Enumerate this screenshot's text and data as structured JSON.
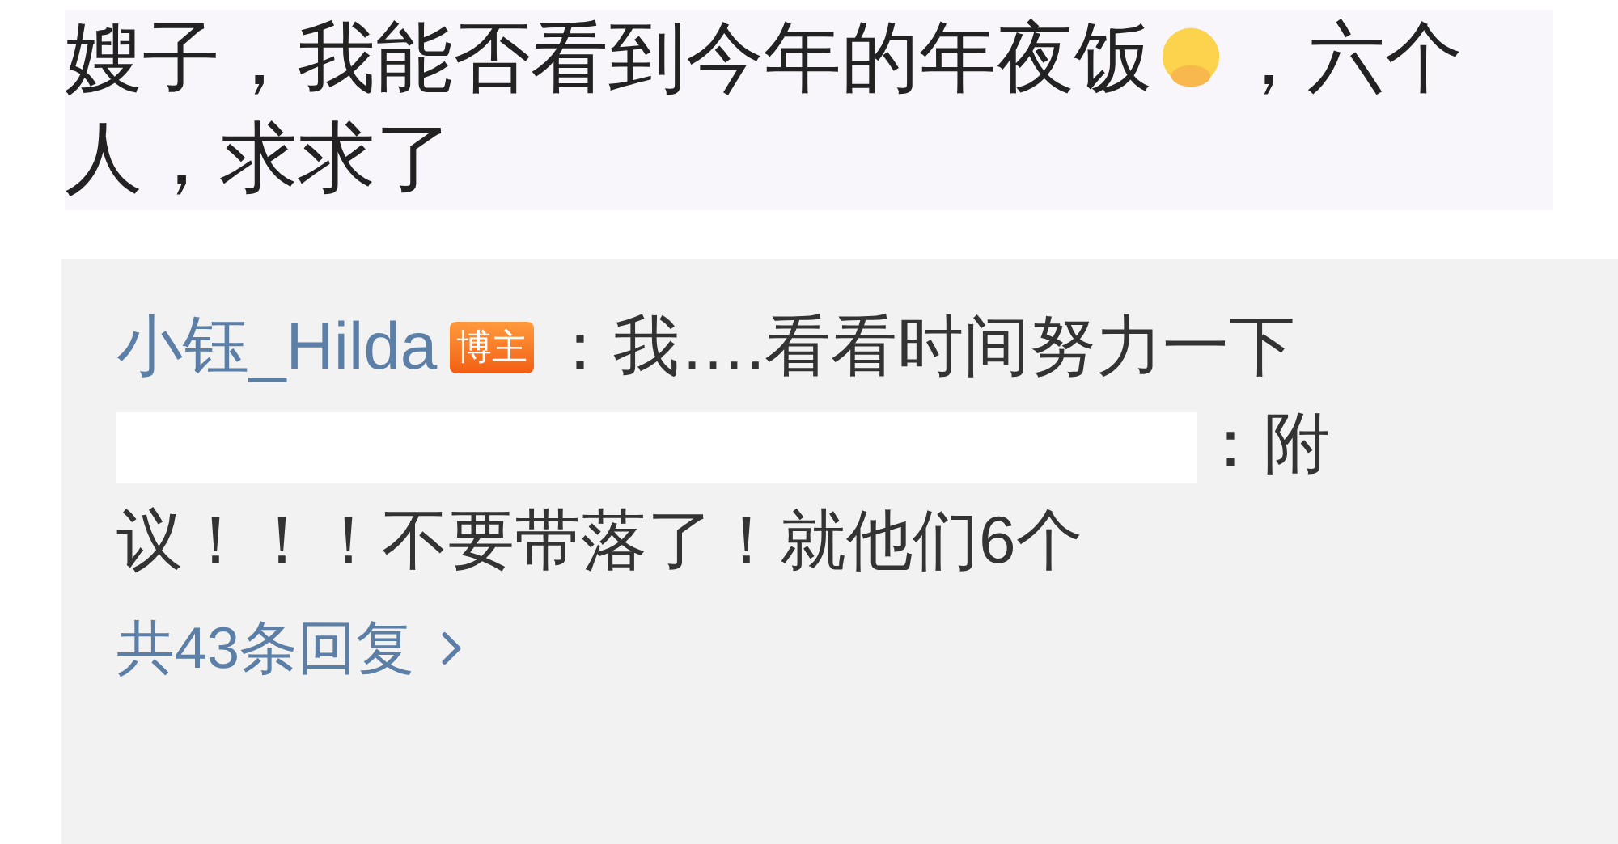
{
  "comment": {
    "text": "嫂子，我能否看到今年的年夜饭",
    "text_after_emoji": "，六个人，求求了"
  },
  "replies": [
    {
      "author": "小钰_Hilda",
      "badge": "博主",
      "text": "：我….看看时间努力一下",
      "redacted": false
    },
    {
      "text": "：附议！！！不要带落了！就他们6个",
      "redacted": true
    }
  ],
  "more_link": "共43条回复"
}
